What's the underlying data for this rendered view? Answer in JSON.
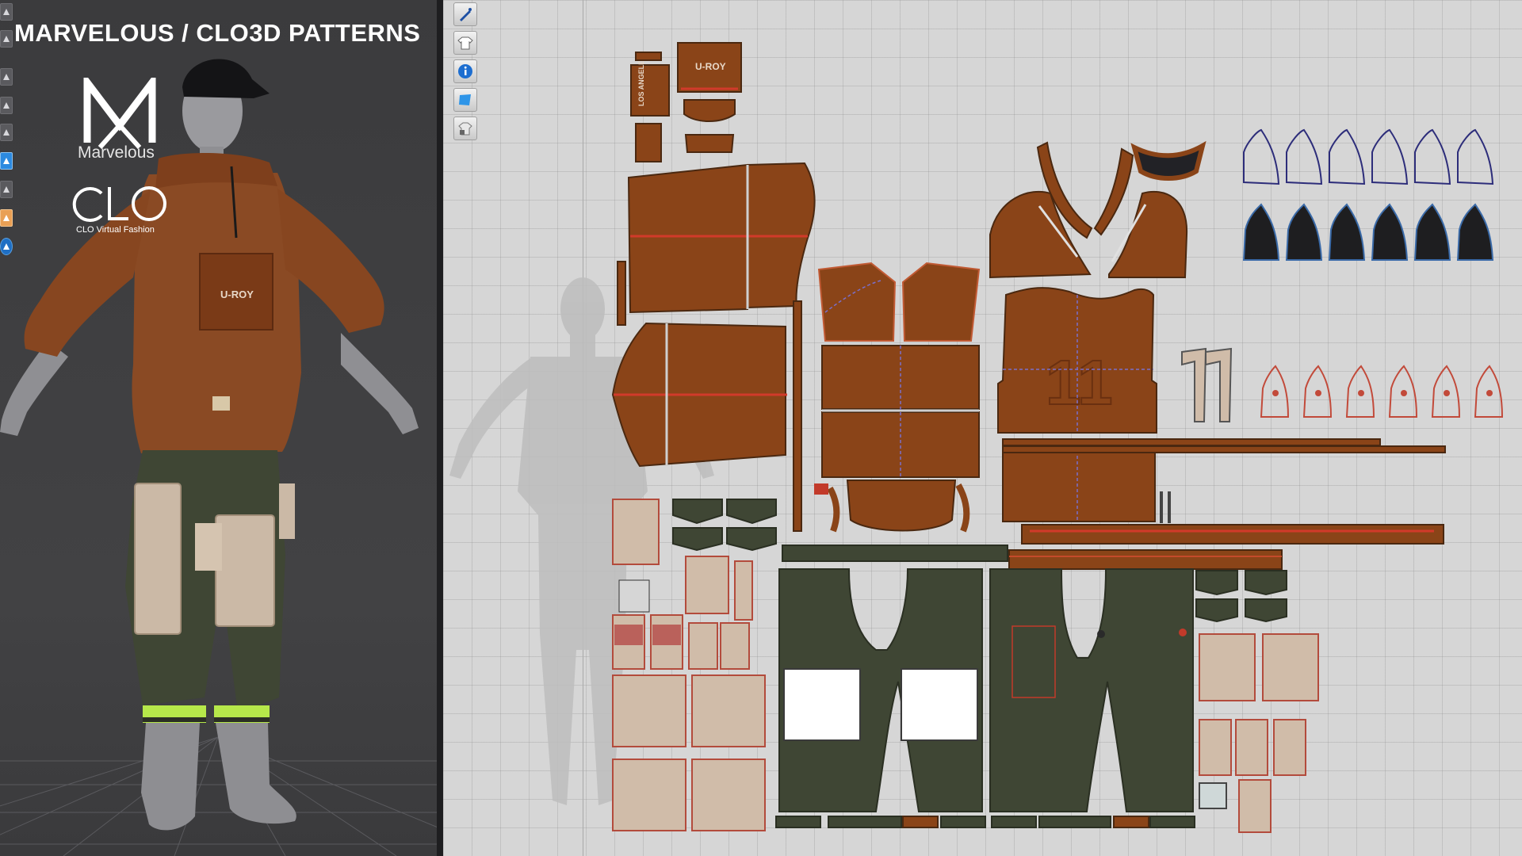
{
  "banner": {
    "title": "MARVELOUS / CLO3D PATTERNS"
  },
  "logos": {
    "marvelous_icon": "marvelous-logo-icon",
    "marvelous_name": "Marvelous",
    "clo_icon": "clo-logo-icon",
    "clo_caption": "CLO Virtual Fashion"
  },
  "viewport_tools": [
    {
      "icon": "cube-icon"
    },
    {
      "icon": "camera-icon"
    },
    {
      "icon": "shirt-icon"
    },
    {
      "icon": "avatar-edit-icon"
    },
    {
      "icon": "avatar-icon"
    },
    {
      "icon": "fabric-icon"
    },
    {
      "icon": "iron-icon"
    },
    {
      "icon": "avatar-texture-icon"
    },
    {
      "icon": "globe-icon"
    }
  ],
  "pattern_tools": [
    {
      "icon": "pen-tool-icon"
    },
    {
      "icon": "garment-icon"
    },
    {
      "icon": "info-icon"
    },
    {
      "icon": "fabric-view-icon"
    },
    {
      "icon": "lock-garment-icon"
    }
  ],
  "garment_labels": {
    "chest_logo": "U-ROY",
    "sleeve_logo": "LOS ANGELES",
    "number_print": "11"
  },
  "colors": {
    "jacket": "#8a4418",
    "pants": "#3f4634",
    "pocket": "#d0bca9",
    "canvas": "#d6d6d6",
    "viewport": "#3d3d3f",
    "neon_cuff": "#b6e84a",
    "accent_line": "#d13a2a"
  }
}
